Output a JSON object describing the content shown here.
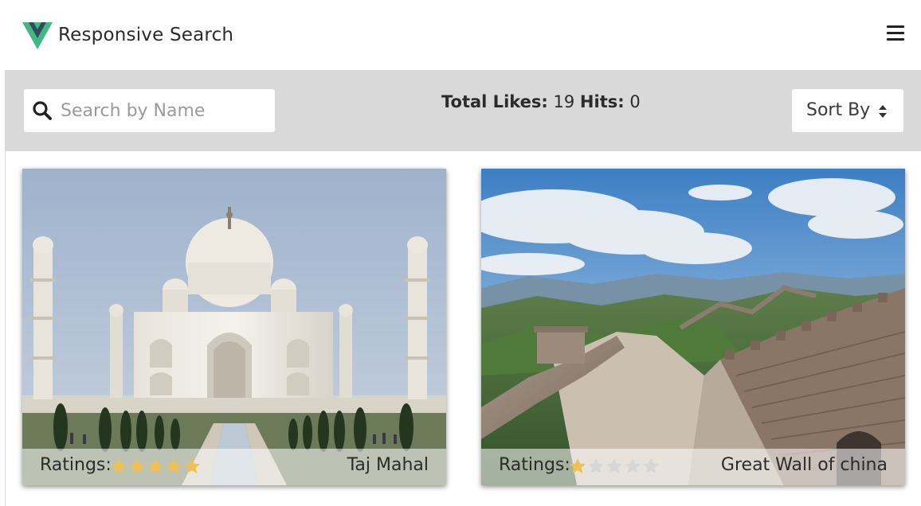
{
  "header": {
    "title": "Responsive Search",
    "logo_icon": "vue-logo-icon",
    "menu_icon": "hamburger-menu-icon"
  },
  "toolbar": {
    "search_placeholder": "Search by Name",
    "search_value": "",
    "total_likes_label": "Total Likes:",
    "total_likes_value": "19",
    "hits_label": "Hits:",
    "hits_value": "0",
    "sort_label": "Sort By"
  },
  "cards": [
    {
      "name": "Taj Mahal",
      "ratings_label": "Ratings:",
      "rating": 5,
      "max_rating": 5
    },
    {
      "name": "Great Wall of china",
      "ratings_label": "Ratings:",
      "rating": 1,
      "max_rating": 5
    }
  ],
  "colors": {
    "toolbar_bg": "#d9d9d9",
    "star_filled": "#f0c050",
    "star_empty": "#d6d6d6",
    "logo_green": "#41b883",
    "logo_dark": "#35495e"
  }
}
